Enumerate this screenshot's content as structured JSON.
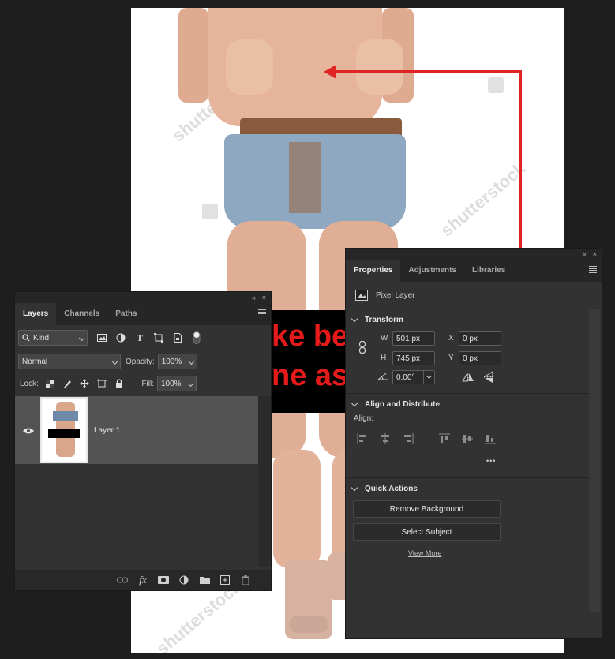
{
  "canvas": {
    "watermark_text": "shutterstock",
    "banner_line1": "ke be",
    "banner_line2": "ne as",
    "colors": {
      "arrow": "#e02424",
      "banner_bg": "#000000",
      "banner_text": "#e51b1b"
    }
  },
  "layers_panel": {
    "tabs": [
      "Layers",
      "Channels",
      "Paths"
    ],
    "filter_kind": "Kind",
    "blend_mode": "Normal",
    "opacity_label": "Opacity:",
    "opacity_value": "100%",
    "lock_label": "Lock:",
    "fill_label": "Fill:",
    "fill_value": "100%",
    "layer": {
      "name": "Layer 1",
      "visible": true
    },
    "filter_icons": [
      "image-filter-icon",
      "adjustment-filter-icon",
      "type-filter-icon",
      "shape-filter-icon",
      "smart-object-filter-icon",
      "filter-toggle-icon"
    ],
    "lock_icons": [
      "lock-transparent-icon",
      "lock-image-icon",
      "lock-position-icon",
      "lock-artboard-icon",
      "lock-all-icon"
    ],
    "bottom_icons": [
      "link-layers-icon",
      "fx-icon",
      "add-mask-icon",
      "new-adjustment-icon",
      "new-group-icon",
      "new-layer-icon",
      "delete-layer-icon"
    ]
  },
  "properties_panel": {
    "tabs": [
      "Properties",
      "Adjustments",
      "Libraries"
    ],
    "layer_type": "Pixel Layer",
    "transform": {
      "title": "Transform",
      "w_label": "W",
      "w_value": "501 px",
      "h_label": "H",
      "h_value": "745 px",
      "x_label": "X",
      "x_value": "0 px",
      "y_label": "Y",
      "y_value": "0 px",
      "angle_value": "0,00°"
    },
    "align": {
      "title": "Align and Distribute",
      "label": "Align:",
      "more": "•••"
    },
    "quick_actions": {
      "title": "Quick Actions",
      "remove_bg": "Remove Background",
      "select_subject": "Select Subject",
      "view_more": "View More"
    }
  },
  "window": {
    "collapse_glyph": "«",
    "close_glyph": "×"
  }
}
